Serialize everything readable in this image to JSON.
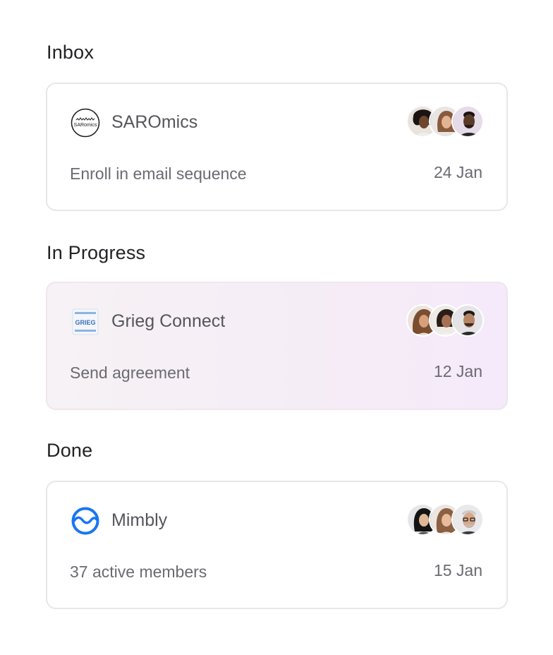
{
  "sections": {
    "inbox": {
      "title": "Inbox",
      "card": {
        "company": "SAROmics",
        "logo_text": "SARomics",
        "task": "Enroll in email sequence",
        "date": "24 Jan"
      }
    },
    "in_progress": {
      "title": "In Progress",
      "card": {
        "company": "Grieg Connect",
        "logo_text": "GRIEG",
        "task": "Send agreement",
        "date": "12 Jan"
      }
    },
    "done": {
      "title": "Done",
      "card": {
        "company": "Mimbly",
        "task": "37 active members",
        "date": "15 Jan"
      }
    }
  },
  "colors": {
    "mimbly_blue": "#1877f2",
    "grieg_blue": "#3d6fb6",
    "progress_card_tint": "#f5ecf7"
  },
  "icons": [
    "saromics-logo-icon",
    "grieg-logo-icon",
    "mimbly-logo-icon",
    "avatar-photo"
  ]
}
